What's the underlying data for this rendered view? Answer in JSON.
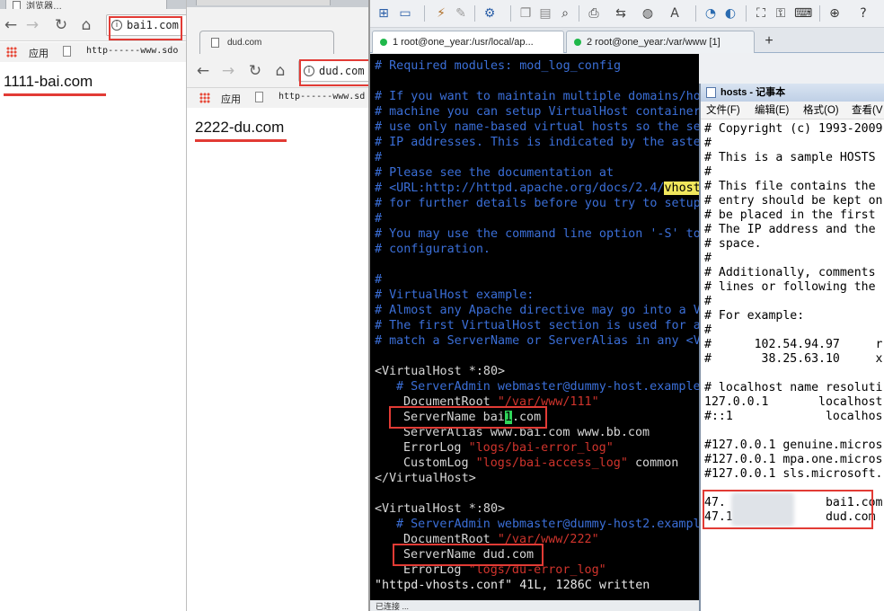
{
  "browser1": {
    "tab_label": "浏览器…",
    "url": "bai1.com",
    "bookmark_apps": "应用",
    "bookmark_item": "http------www.sdo",
    "heading": "1111-bai.com"
  },
  "browser2": {
    "tab_label": "dud.com",
    "url": "dud.com",
    "bookmark_apps": "应用",
    "bookmark_item": "http------www.sd",
    "heading": "2222-du.com"
  },
  "terminal_app": {
    "tabs": [
      {
        "label": "1 root@one_year:/usr/local/ap..."
      },
      {
        "label": "2 root@one_year:/var/www [1]"
      }
    ],
    "add_tab": "+",
    "lines": {
      "l1": "# Required modules: mod_log_config",
      "l2": "# If you want to maintain multiple domains/ho",
      "l3": "# machine you can setup VirtualHost container",
      "l4": "# use only name-based virtual hosts so the se",
      "l5": "# IP addresses. This is indicated by the aste",
      "l6": "#",
      "l7": "# Please see the documentation at",
      "l8a": "# <URL:http://httpd.apache.org/docs/2.4/",
      "l8b": "vhost",
      "l9": "# for further details before you try to setup",
      "l10": "#",
      "l11": "# You may use the command line option '-S' to",
      "l12": "# configuration.",
      "l13": "#",
      "l14": "# VirtualHost example:",
      "l15": "# Almost any Apache directive may go into a V",
      "l16": "# The first VirtualHost section is used for a",
      "l17": "# match a ServerName or ServerAlias in any <V",
      "vh1_open": "<VirtualHost *:80>",
      "vh1_admin": "# ServerAdmin webmaster@dummy-host.example",
      "vh1_docroot_key": "DocumentRoot ",
      "vh1_docroot_val": "\"/var/www/111\"",
      "vh1_servername_a": "ServerName bai",
      "vh1_servername_cursor": "1",
      "vh1_servername_b": ".com",
      "vh1_alias": "ServerAlias www.bai.com www.bb.com",
      "vh1_errlog_key": "ErrorLog ",
      "vh1_errlog_val": "\"logs/bai-error_log\"",
      "vh1_customlog_key": "CustomLog ",
      "vh1_customlog_val": "\"logs/bai-access_log\"",
      "vh1_customlog_tail": " common",
      "vh1_close": "</VirtualHost>",
      "vh2_open": "<VirtualHost *:80>",
      "vh2_admin": "# ServerAdmin webmaster@dummy-host2.exampl",
      "vh2_docroot_key": "DocumentRoot ",
      "vh2_docroot_val": "\"/var/www/222\"",
      "vh2_servername": "ServerName dud.com",
      "vh2_errlog_key": "ErrorLog ",
      "vh2_errlog_val": "\"logs/du-error_log\"",
      "status": "\"httpd-vhosts.conf\" 41L, 1286C written"
    },
    "statusbar": "已连接 ..."
  },
  "notepad": {
    "title": "hosts - 记事本",
    "menu": [
      "文件(F)",
      "编辑(E)",
      "格式(O)",
      "查看(V"
    ],
    "lines": [
      "# Copyright (c) 1993-2009",
      "#",
      "# This is a sample HOSTS",
      "#",
      "# This file contains the",
      "# entry should be kept on",
      "# be placed in the first",
      "# The IP address and the",
      "# space.",
      "#",
      "# Additionally, comments",
      "# lines or following the",
      "#",
      "# For example:",
      "#",
      "#      102.54.94.97     r",
      "#       38.25.63.10     x",
      "",
      "# localhost name resoluti",
      "127.0.0.1       localhost",
      "#::1             localhos",
      "",
      "#127.0.0.1 genuine.micros",
      "#127.0.0.1 mpa.one.micros",
      "#127.0.0.1 sls.microsoft.",
      "",
      "47.              bai1.com",
      "47.1             dud.com"
    ]
  },
  "colors": {
    "annotation_red": "#e23b35",
    "terminal_bg": "#000000",
    "comment_blue": "#3b6fd8",
    "string_red": "#d0342c",
    "cursor_green": "#2fd65a",
    "highlight_yellow": "#f1e75c"
  },
  "icons": [
    "back-arrow-icon",
    "forward-arrow-icon",
    "reload-icon",
    "home-icon",
    "info-icon",
    "apps-grid-icon",
    "page-icon"
  ]
}
